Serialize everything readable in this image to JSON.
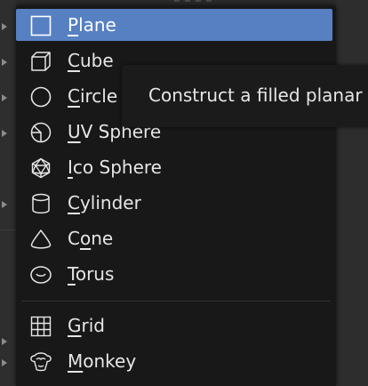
{
  "menu": {
    "items": [
      {
        "label": "Plane",
        "ul": "P",
        "rest": "lane",
        "icon": "plane-icon",
        "active": true
      },
      {
        "label": "Cube",
        "ul": "C",
        "rest": "ube",
        "icon": "cube-icon"
      },
      {
        "label": "Circle",
        "ul": "C",
        "rest": "ircle",
        "icon": "circle-icon"
      },
      {
        "label": "UV Sphere",
        "ul": "U",
        "rest": "V Sphere",
        "icon": "uv-sphere-icon"
      },
      {
        "label": "Ico Sphere",
        "ul": "I",
        "rest": "co Sphere",
        "icon": "ico-sphere-icon"
      },
      {
        "label": "Cylinder",
        "ul": "C",
        "rest": "ylinder",
        "icon": "cylinder-icon"
      },
      {
        "label": "Cone",
        "ul": "",
        "pre": "C",
        "mid": "o",
        "post": "ne",
        "icon": "cone-icon"
      },
      {
        "label": "Torus",
        "ul": "T",
        "rest": "orus",
        "icon": "torus-icon"
      },
      {
        "label": "Grid",
        "ul": "G",
        "rest": "rid",
        "icon": "grid-icon"
      },
      {
        "label": "Monkey",
        "ul": "M",
        "rest": "onkey",
        "icon": "monkey-icon"
      }
    ]
  },
  "tooltip": {
    "text": "Construct a filled planar m"
  },
  "colors": {
    "active": "#5680c2",
    "menu_bg": "#181818",
    "text": "#e6e6e6"
  }
}
